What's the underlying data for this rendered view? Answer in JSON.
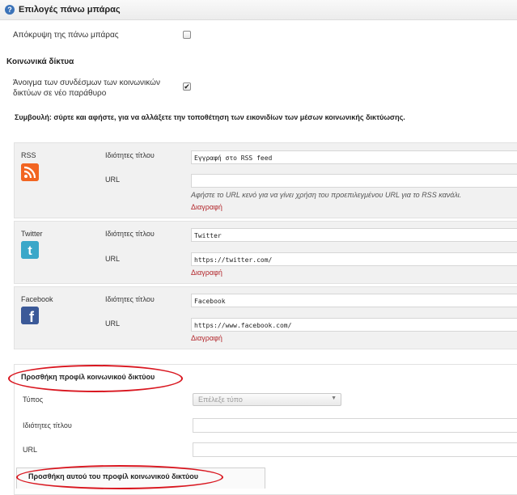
{
  "header": {
    "title": "Επιλογές πάνω μπάρας"
  },
  "options": {
    "hide_topbar_label": "Απόκρυψη της πάνω μπάρας",
    "hide_topbar_checked": false
  },
  "social": {
    "section_title": "Κοινωνικά δίκτυα",
    "open_new_window_label_line1": "Άνοιγμα των συνδέσμων των κοινωνικών",
    "open_new_window_label_line2": "δικτύων σε νέο παράθυρο",
    "open_new_window_checked": true,
    "tip": "Συμβουλή: σύρτε και αφήστε, για να αλλάξετε την τοποθέτηση των εικονιδίων των μέσων κοινωνικής δικτύωσης."
  },
  "networks": [
    {
      "name": "RSS",
      "title_label": "Ιδιότητες τίτλου",
      "title_value": "Εγγραφή στο RSS feed",
      "url_label": "URL",
      "url_value": "",
      "help_text": "Αφήστε το URL κενό για να γίνει χρήση του προεπιλεγμένου URL για το RSS κανάλι.",
      "delete_label": "Διαγραφή",
      "icon": "rss-icon",
      "color": "#f26522"
    },
    {
      "name": "Twitter",
      "title_label": "Ιδιότητες τίτλου",
      "title_value": "Twitter",
      "url_label": "URL",
      "url_value": "https://twitter.com/",
      "delete_label": "Διαγραφή",
      "icon": "twitter-icon",
      "color": "#3ba7c9"
    },
    {
      "name": "Facebook",
      "title_label": "Ιδιότητες τίτλου",
      "title_value": "Facebook",
      "url_label": "URL",
      "url_value": "https://www.facebook.com/",
      "delete_label": "Διαγραφή",
      "icon": "facebook-icon",
      "color": "#3b5998"
    }
  ],
  "add_profile": {
    "heading": "Προσθήκη προφίλ κοινωνικού δικτύου",
    "type_label": "Τύπος",
    "type_placeholder": "Επέλεξε τύπο",
    "title_label": "Ιδιότητες τίτλου",
    "url_label": "URL",
    "button_label": "Προσθήκη αυτού του προφίλ κοινωνικού δικτύου"
  },
  "colors": {
    "delete_link": "#b3282d",
    "annotation_ellipse": "#d9161f"
  }
}
